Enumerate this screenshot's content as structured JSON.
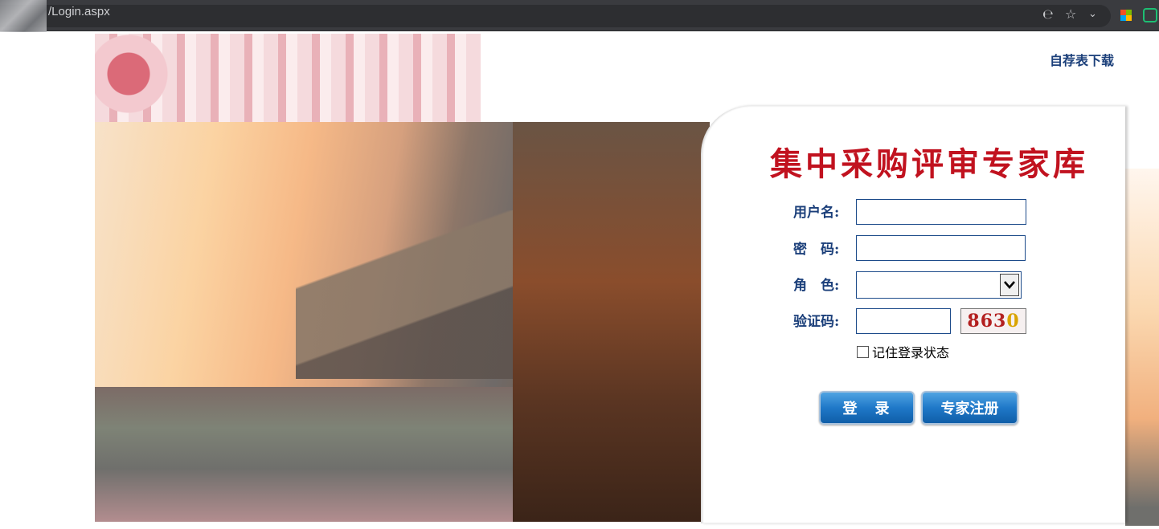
{
  "browser": {
    "url": "/Login.aspx",
    "icons": [
      "edge-icon",
      "star-icon",
      "chevron-down-icon",
      "microsoft-icon",
      "extension-icon"
    ]
  },
  "header": {
    "download_link": "自荐表下载"
  },
  "login": {
    "title": "集中采购评审专家库",
    "username_label": "用户名:",
    "password_label": "密　码:",
    "role_label": "角　色:",
    "captcha_label": "验证码:",
    "username_value": "",
    "password_value": "",
    "role_value": "",
    "captcha_value": "",
    "captcha_code": [
      "8",
      "6",
      "3",
      "0"
    ],
    "remember_label": "记住登录状态",
    "login_button": "登　录",
    "register_button": "专家注册"
  },
  "colors": {
    "title": "#c1121f",
    "label": "#1b3f7a",
    "button": "#1f78c8"
  }
}
